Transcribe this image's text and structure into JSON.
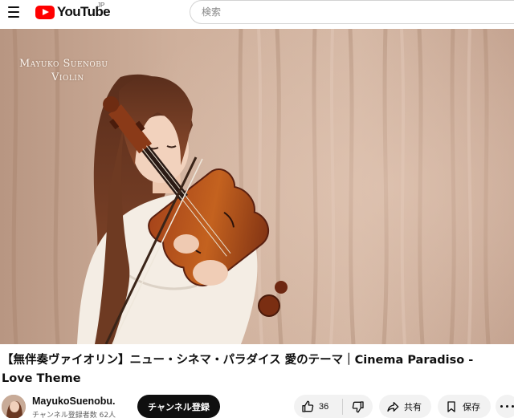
{
  "header": {
    "logo_text": "YouTube",
    "country": "JP",
    "search_placeholder": "検索"
  },
  "video": {
    "watermark_line1": "Mayuko Suenobu",
    "watermark_line2": "Violin"
  },
  "title": "【無伴奏ヴァイオリン】ニュー・シネマ・パラダイス 愛のテーマ｜Cinema Paradiso - Love Theme",
  "channel": {
    "name": "MayukoSuenobu.",
    "subscribers": "チャンネル登録者数 62人",
    "subscribe_label": "チャンネル登録"
  },
  "actions": {
    "like_count": "36",
    "share_label": "共有",
    "save_label": "保存"
  },
  "colors": {
    "brand_red": "#ff0000",
    "subscribe_bg": "#0f0f0f",
    "pill_bg": "#f2f2f2"
  }
}
